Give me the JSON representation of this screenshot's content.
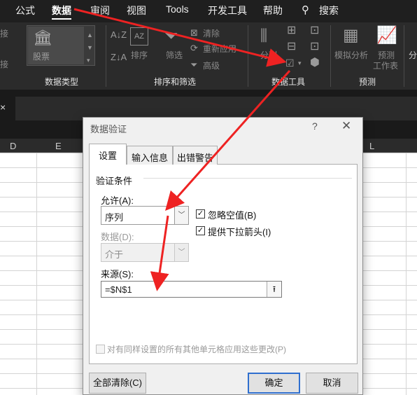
{
  "ribbon": {
    "tabs": [
      {
        "label": "公式"
      },
      {
        "label": "数据"
      },
      {
        "label": "审阅"
      },
      {
        "label": "视图"
      },
      {
        "label": "Tools"
      },
      {
        "label": "开发工具"
      },
      {
        "label": "帮助"
      }
    ],
    "search_label": "搜索",
    "edge_label_left1": "接",
    "edge_label_left2": "接",
    "edge_label_right": "分",
    "groups": {
      "data_types": {
        "label": "数据类型",
        "stock_label": "股票"
      },
      "sort_filter": {
        "label": "排序和筛选",
        "sort": "排序",
        "filter": "筛选",
        "clear": "清除",
        "reapply": "重新应用",
        "advanced": "高级"
      },
      "data_tools": {
        "label": "数据工具",
        "split": "分列"
      },
      "forecast": {
        "label": "预测",
        "whatif": "模拟分析",
        "forecast_sheet_1": "预测",
        "forecast_sheet_2": "工作表"
      }
    }
  },
  "sheet": {
    "columns": [
      "D",
      "E",
      "L"
    ]
  },
  "dialog": {
    "title": "数据验证",
    "help": "?",
    "close": "✕",
    "tabs": [
      {
        "label": "设置"
      },
      {
        "label": "输入信息"
      },
      {
        "label": "出错警告"
      }
    ],
    "section_title": "验证条件",
    "allow_label": "允许(A):",
    "allow_value": "序列",
    "data_label": "数据(D):",
    "data_value": "介于",
    "ignore_blank": "忽略空值(B)",
    "ignore_blank_checked": "✓",
    "dropdown": "提供下拉箭头(I)",
    "dropdown_checked": "✓",
    "source_label": "来源(S):",
    "source_value": "=$N$1",
    "apply_all": "对有同样设置的所有其他单元格应用这些更改(P)",
    "clear_all": "全部清除(C)",
    "ok": "确定",
    "cancel": "取消"
  },
  "colors": {
    "annotation_arrow": "#ee2222",
    "ribbon_bg": "#2b2b2b",
    "ok_border": "#2f6fcf"
  }
}
